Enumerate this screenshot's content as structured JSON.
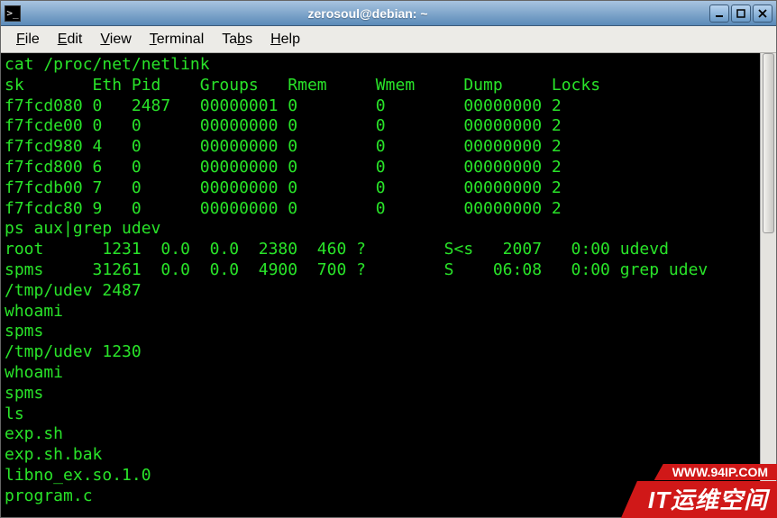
{
  "window": {
    "title": "zerosoul@debian: ~"
  },
  "menubar": {
    "items": [
      {
        "accel": "F",
        "rest": "ile"
      },
      {
        "accel": "E",
        "rest": "dit"
      },
      {
        "accel": "V",
        "rest": "iew"
      },
      {
        "accel": "T",
        "rest": "erminal"
      },
      {
        "accel": "",
        "rest": "Ta",
        "accel2": "b",
        "rest2": "s"
      },
      {
        "accel": "H",
        "rest": "elp"
      }
    ]
  },
  "terminal_lines": [
    "cat /proc/net/netlink",
    "sk       Eth Pid    Groups   Rmem     Wmem     Dump     Locks",
    "f7fcd080 0   2487   00000001 0        0        00000000 2",
    "f7fcde00 0   0      00000000 0        0        00000000 2",
    "f7fcd980 4   0      00000000 0        0        00000000 2",
    "f7fcd800 6   0      00000000 0        0        00000000 2",
    "f7fcdb00 7   0      00000000 0        0        00000000 2",
    "f7fcdc80 9   0      00000000 0        0        00000000 2",
    "ps aux|grep udev",
    "root      1231  0.0  0.0  2380  460 ?        S<s   2007   0:00 udevd",
    "spms     31261  0.0  0.0  4900  700 ?        S    06:08   0:00 grep udev",
    "/tmp/udev 2487",
    "whoami",
    "spms",
    "/tmp/udev 1230",
    "whoami",
    "spms",
    "ls",
    "exp.sh",
    "exp.sh.bak",
    "libno_ex.so.1.0",
    "program.c"
  ],
  "watermark": {
    "top": "WWW.94IP.COM",
    "bottom": "IT运维空间"
  }
}
